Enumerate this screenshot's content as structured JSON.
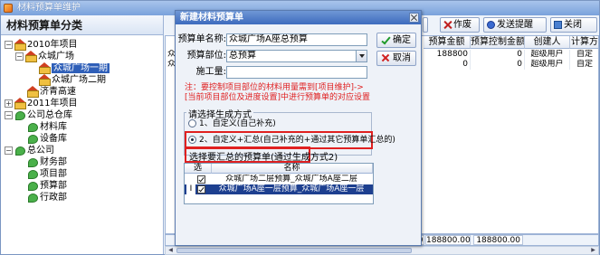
{
  "window": {
    "title": "材料预算单维护"
  },
  "left_panel": {
    "header": "材料预算单分类",
    "tree": [
      {
        "label": "2010年项目",
        "expander": "−",
        "icon": "house-icon",
        "level": 0
      },
      {
        "label": "众城广场",
        "expander": "−",
        "icon": "house-icon",
        "level": 1
      },
      {
        "label": "众城广场一期",
        "expander": "",
        "icon": "house-icon",
        "level": 2,
        "selected": true
      },
      {
        "label": "众城广场二期",
        "expander": "",
        "icon": "house-icon",
        "level": 2
      },
      {
        "label": "济青高速",
        "expander": "",
        "icon": "house-icon",
        "level": 1
      },
      {
        "label": "2011年项目",
        "expander": "+",
        "icon": "house-icon",
        "level": 0
      },
      {
        "label": "公司总仓库",
        "expander": "−",
        "icon": "leaf-icon",
        "level": 0
      },
      {
        "label": "材料库",
        "expander": "",
        "icon": "leaf-icon",
        "level": 1
      },
      {
        "label": "设备库",
        "expander": "",
        "icon": "leaf-icon",
        "level": 1
      },
      {
        "label": "总公司",
        "expander": "−",
        "icon": "leaf-icon",
        "level": 0
      },
      {
        "label": "财务部",
        "expander": "",
        "icon": "leaf-icon",
        "level": 1
      },
      {
        "label": "项目部",
        "expander": "",
        "icon": "leaf-icon",
        "level": 1
      },
      {
        "label": "预算部",
        "expander": "",
        "icon": "leaf-icon",
        "level": 1
      },
      {
        "label": "行政部",
        "expander": "",
        "icon": "leaf-icon",
        "level": 1
      }
    ]
  },
  "toolbar": {
    "void_label": "作废",
    "remind_label": "发送提醒",
    "close_label": "关闭"
  },
  "grid": {
    "columns": [
      "预算金额",
      "预算控制金额",
      "创建人",
      "计算方"
    ],
    "rows": [
      {
        "prefix": "众",
        "amount": "188800",
        "control": "0",
        "creator": "超级用户",
        "calc": "自定"
      },
      {
        "prefix": "众",
        "amount": "0",
        "control": "0",
        "creator": "超级用户",
        "calc": "自定"
      }
    ],
    "footer_amount": "188800.00",
    "footer_control": "188800.00",
    "footer_left_value": "00"
  },
  "dialog": {
    "title": "新建材料预算单",
    "name_label": "预算单名称:",
    "name_value": "众城广场A座总预算",
    "dept_label": "预算部位:",
    "dept_value": "总预算",
    "qty_label": "施工量:",
    "qty_value": "",
    "ok_label": "确定",
    "cancel_label": "取消",
    "note": "注：要控制项目部位的材料用量需到[项目维护]->[当前项目部位及进度设置]中进行预算单的对应设置",
    "method_legend": "请选择生成方式",
    "option1": "1、自定义(自己补充)",
    "option2": "2、自定义+汇总(自己补充的+通过其它预算单汇总的)",
    "select_legend": "选择要汇总的预算单(通过生成方式2)",
    "sub_columns": [
      "选",
      "名称"
    ],
    "sub_rows": [
      {
        "indicator": "",
        "checked": true,
        "name": "众城广场二层预算_众城广场A座二层"
      },
      {
        "indicator": "I",
        "checked": true,
        "name": "众城广场A座一层预算_众城广场A座一层"
      }
    ]
  }
}
